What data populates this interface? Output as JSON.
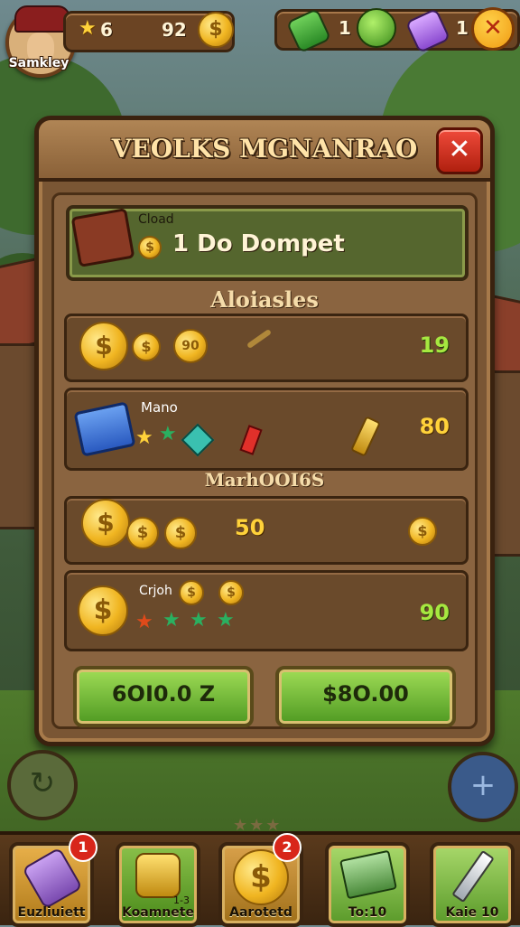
{
  "hud": {
    "player_name": "Samkley",
    "level": "6",
    "coins": "92",
    "item1_count": "1",
    "item2_count": "1"
  },
  "panel": {
    "title": "VEOLKS MGNANRAO",
    "close": "✕"
  },
  "wallet": {
    "label": "Cload",
    "value": "1 Do Dompet"
  },
  "sections": {
    "first": "Aloiasles",
    "second": "MarhOOI6S"
  },
  "rows": [
    {
      "label": "",
      "coin_text": "",
      "coin_text2": "90",
      "value": "19"
    },
    {
      "label": "Mano",
      "value": "80"
    },
    {
      "label": "",
      "center": "50",
      "value": ""
    },
    {
      "label": "Crjoh",
      "value": "90"
    }
  ],
  "buttons": {
    "left": "6OI0.0 Z",
    "right": "$8O.00"
  },
  "tabs": [
    {
      "label": "Euzliuiett",
      "badge": "1"
    },
    {
      "label": "Koamnete",
      "sub": "1-3"
    },
    {
      "label": "Aarotetd",
      "badge": "2"
    },
    {
      "label": "To:10"
    },
    {
      "label": "Kaie 10"
    }
  ],
  "icons": {
    "star": "★",
    "dollar": "$",
    "close_x": "✕"
  }
}
